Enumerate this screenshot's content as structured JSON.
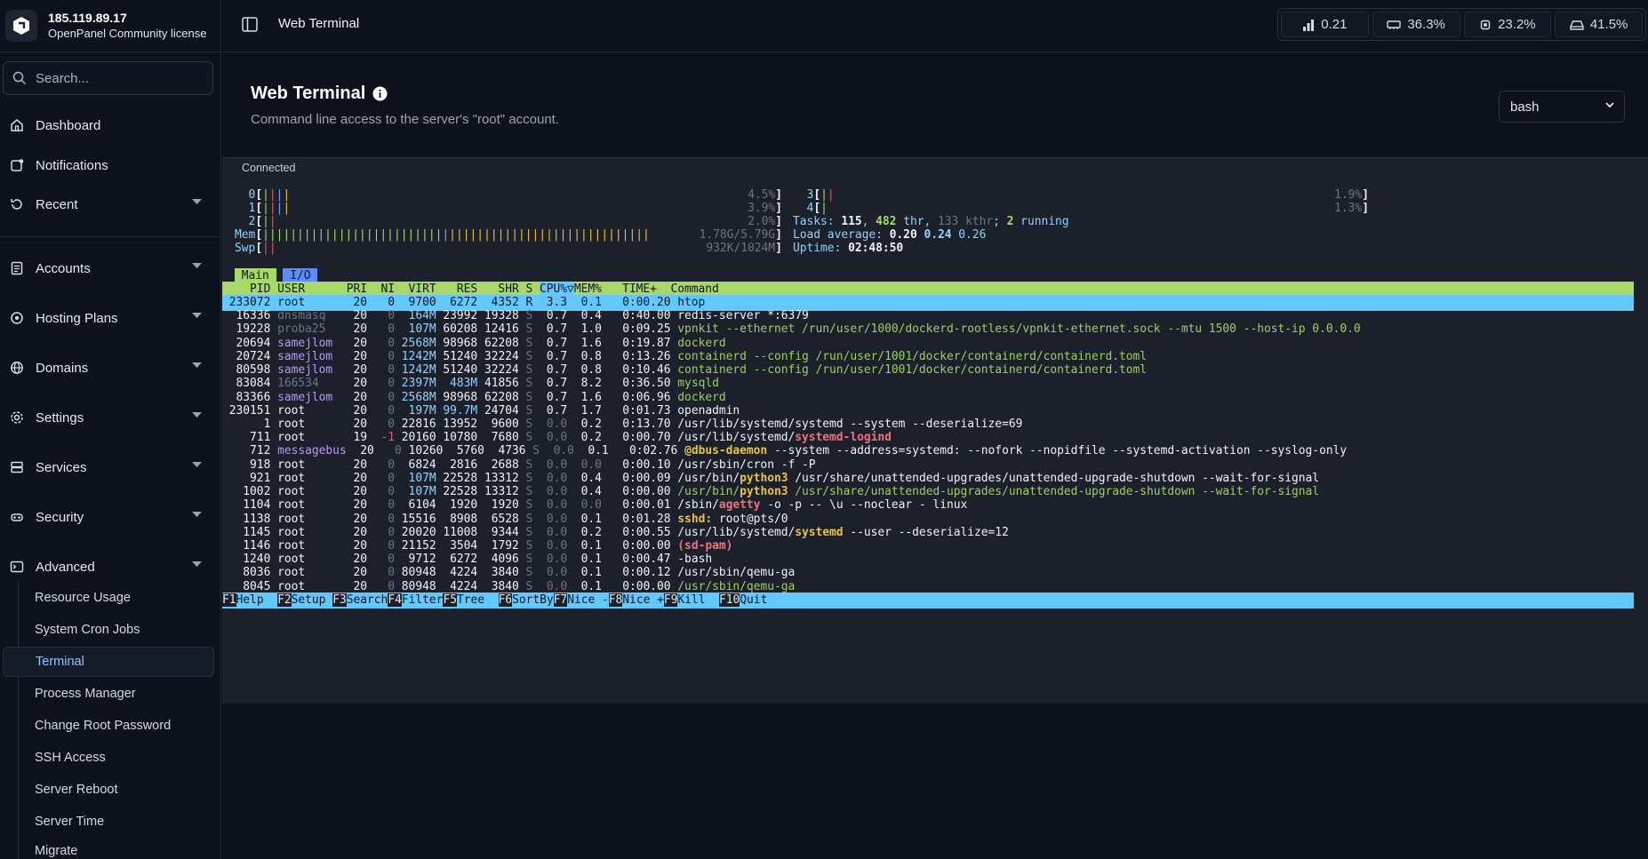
{
  "brand": {
    "ip": "185.119.89.17",
    "license": "OpenPanel Community license"
  },
  "search": {
    "placeholder": "Search..."
  },
  "nav": {
    "dashboard": "Dashboard",
    "notifications": "Notifications",
    "recent": "Recent",
    "accounts": "Accounts",
    "hosting_plans": "Hosting Plans",
    "domains": "Domains",
    "settings": "Settings",
    "services": "Services",
    "security": "Security",
    "advanced": "Advanced",
    "advanced_items": [
      "Resource Usage",
      "System Cron Jobs",
      "Terminal",
      "Process Manager",
      "Change Root Password",
      "SSH Access",
      "Server Reboot",
      "Server Time",
      "Migrate"
    ]
  },
  "topbar": {
    "title": "Web Terminal",
    "stats": {
      "load": "0.21",
      "mem": "36.3%",
      "cpu": "23.2%",
      "disk": "41.5%"
    }
  },
  "page": {
    "title": "Web Terminal",
    "description": "Command line access to the server's \"root\" account.",
    "shell": "bash"
  },
  "terminal": {
    "status": "Connected",
    "cpus": [
      {
        "label": "0",
        "bars": "||||",
        "pct": "4.5%"
      },
      {
        "label": "1",
        "bars": "||||",
        "pct": "3.9%"
      },
      {
        "label": "2",
        "bars": "||",
        "pct": "2.0%"
      },
      {
        "label": "3",
        "bars": "||",
        "pct": "1.9%"
      },
      {
        "label": "4",
        "bars": "|",
        "pct": "1.3%"
      }
    ],
    "mem": {
      "label": "Mem",
      "value": "1.78G/5.79G"
    },
    "swp": {
      "label": "Swp",
      "value": "932K/1024M"
    },
    "tasks": {
      "prefix": "Tasks: ",
      "count": "115",
      "thr": "482",
      "thr_label": " thr",
      "kthr": "133 kthr",
      "running": "2",
      "running_label": " running"
    },
    "load": {
      "prefix": "Load average: ",
      "v1": "0.20",
      "v2": "0.24",
      "v3": "0.26"
    },
    "uptime": {
      "prefix": "Uptime: ",
      "value": "02:48:50"
    },
    "tabs": [
      "Main",
      "I/O"
    ],
    "header": {
      "pid": "PID",
      "user": "USER",
      "pri": "PRI",
      "ni": "NI",
      "virt": "VIRT",
      "res": "RES",
      "shr": "SHR",
      "s": "S",
      "cpu": "CPU%▽",
      "mem": "MEM%",
      "time": "TIME+",
      "cmd": "Command"
    },
    "processes": [
      {
        "pid": "233072",
        "user": "root",
        "pri": "20",
        "ni": "0",
        "virt": "9700",
        "res": "6272",
        "shr": "4352",
        "s": "R",
        "cpu": "3.3",
        "mem": "0.1",
        "time": "0:00.20",
        "cmd": "htop",
        "selected": true
      },
      {
        "pid": "16336",
        "user": "dnsmasq",
        "pri": "20",
        "ni": "0",
        "virt": "164M",
        "res": "23992",
        "shr": "19328",
        "s": "S",
        "cpu": "0.7",
        "mem": "0.4",
        "time": "0:40.00",
        "cmd": "redis-server *:6379"
      },
      {
        "pid": "19228",
        "user": "proba25",
        "pri": "20",
        "ni": "0",
        "virt": "107M",
        "res": "60208",
        "shr": "12416",
        "s": "S",
        "cpu": "0.7",
        "mem": "1.0",
        "time": "0:09.25",
        "cmd": "vpnkit --ethernet /run/user/1000/dockerd-rootless/vpnkit-ethernet.sock --mtu 1500 --host-ip 0.0.0.0"
      },
      {
        "pid": "20694",
        "user": "samejlom",
        "pri": "20",
        "ni": "0",
        "virt": "2568M",
        "res": "98968",
        "shr": "62208",
        "s": "S",
        "cpu": "0.7",
        "mem": "1.6",
        "time": "0:19.87",
        "cmd": "dockerd"
      },
      {
        "pid": "20724",
        "user": "samejlom",
        "pri": "20",
        "ni": "0",
        "virt": "1242M",
        "res": "51240",
        "shr": "32224",
        "s": "S",
        "cpu": "0.7",
        "mem": "0.8",
        "time": "0:13.26",
        "cmd": "containerd --config /run/user/1001/docker/containerd/containerd.toml"
      },
      {
        "pid": "80598",
        "user": "samejlom",
        "pri": "20",
        "ni": "0",
        "virt": "1242M",
        "res": "51240",
        "shr": "32224",
        "s": "S",
        "cpu": "0.7",
        "mem": "0.8",
        "time": "0:10.46",
        "cmd": "containerd --config /run/user/1001/docker/containerd/containerd.toml"
      },
      {
        "pid": "83084",
        "user": "166534",
        "pri": "20",
        "ni": "0",
        "virt": "2397M",
        "res": "483M",
        "shr": "41856",
        "s": "S",
        "cpu": "0.7",
        "mem": "8.2",
        "time": "0:36.50",
        "cmd": "mysqld"
      },
      {
        "pid": "83366",
        "user": "samejlom",
        "pri": "20",
        "ni": "0",
        "virt": "2568M",
        "res": "98968",
        "shr": "62208",
        "s": "S",
        "cpu": "0.7",
        "mem": "1.6",
        "time": "0:06.96",
        "cmd": "dockerd"
      },
      {
        "pid": "230151",
        "user": "root",
        "pri": "20",
        "ni": "0",
        "virt": "197M",
        "res": "99.7M",
        "shr": "24704",
        "s": "S",
        "cpu": "0.7",
        "mem": "1.7",
        "time": "0:01.73",
        "cmd": "openadmin"
      },
      {
        "pid": "1",
        "user": "root",
        "pri": "20",
        "ni": "0",
        "virt": "22816",
        "res": "13952",
        "shr": "9600",
        "s": "S",
        "cpu": "0.0",
        "mem": "0.2",
        "time": "0:13.70",
        "cmd": "/usr/lib/systemd/systemd --system --deserialize=69"
      },
      {
        "pid": "711",
        "user": "root",
        "pri": "19",
        "ni": "-1",
        "virt": "20160",
        "res": "10780",
        "shr": "7680",
        "s": "S",
        "cpu": "0.0",
        "mem": "0.2",
        "time": "0:00.70",
        "cmd": "/usr/lib/systemd/systemd-logind"
      },
      {
        "pid": "712",
        "user": "messagebus",
        "pri": "20",
        "ni": "0",
        "virt": "10260",
        "res": "5760",
        "shr": "4736",
        "s": "S",
        "cpu": "0.0",
        "mem": "0.1",
        "time": "0:02.76",
        "cmd": "@dbus-daemon --system --address=systemd: --nofork --nopidfile --systemd-activation --syslog-only"
      },
      {
        "pid": "918",
        "user": "root",
        "pri": "20",
        "ni": "0",
        "virt": "6824",
        "res": "2816",
        "shr": "2688",
        "s": "S",
        "cpu": "0.0",
        "mem": "0.0",
        "time": "0:00.10",
        "cmd": "/usr/sbin/cron -f -P"
      },
      {
        "pid": "921",
        "user": "root",
        "pri": "20",
        "ni": "0",
        "virt": "107M",
        "res": "22528",
        "shr": "13312",
        "s": "S",
        "cpu": "0.0",
        "mem": "0.4",
        "time": "0:00.09",
        "cmd": "/usr/bin/python3 /usr/share/unattended-upgrades/unattended-upgrade-shutdown --wait-for-signal"
      },
      {
        "pid": "1002",
        "user": "root",
        "pri": "20",
        "ni": "0",
        "virt": "107M",
        "res": "22528",
        "shr": "13312",
        "s": "S",
        "cpu": "0.0",
        "mem": "0.4",
        "time": "0:00.00",
        "cmd": "/usr/bin/python3 /usr/share/unattended-upgrades/unattended-upgrade-shutdown --wait-for-signal"
      },
      {
        "pid": "1104",
        "user": "root",
        "pri": "20",
        "ni": "0",
        "virt": "6104",
        "res": "1920",
        "shr": "1920",
        "s": "S",
        "cpu": "0.0",
        "mem": "0.0",
        "time": "0:00.01",
        "cmd": "/sbin/agetty -o -p -- \\u --noclear - linux"
      },
      {
        "pid": "1138",
        "user": "root",
        "pri": "20",
        "ni": "0",
        "virt": "15516",
        "res": "8908",
        "shr": "6528",
        "s": "S",
        "cpu": "0.0",
        "mem": "0.1",
        "time": "0:01.28",
        "cmd": "sshd: root@pts/0"
      },
      {
        "pid": "1145",
        "user": "root",
        "pri": "20",
        "ni": "0",
        "virt": "20020",
        "res": "11008",
        "shr": "9344",
        "s": "S",
        "cpu": "0.0",
        "mem": "0.2",
        "time": "0:00.55",
        "cmd": "/usr/lib/systemd/systemd --user --deserialize=12"
      },
      {
        "pid": "1146",
        "user": "root",
        "pri": "20",
        "ni": "0",
        "virt": "21152",
        "res": "3504",
        "shr": "1792",
        "s": "S",
        "cpu": "0.0",
        "mem": "0.1",
        "time": "0:00.00",
        "cmd": "(sd-pam)"
      },
      {
        "pid": "1240",
        "user": "root",
        "pri": "20",
        "ni": "0",
        "virt": "9712",
        "res": "6272",
        "shr": "4096",
        "s": "S",
        "cpu": "0.0",
        "mem": "0.1",
        "time": "0:00.47",
        "cmd": "-bash"
      },
      {
        "pid": "8036",
        "user": "root",
        "pri": "20",
        "ni": "0",
        "virt": "80948",
        "res": "4224",
        "shr": "3840",
        "s": "S",
        "cpu": "0.0",
        "mem": "0.1",
        "time": "0:00.12",
        "cmd": "/usr/sbin/qemu-ga"
      },
      {
        "pid": "8045",
        "user": "root",
        "pri": "20",
        "ni": "0",
        "virt": "80948",
        "res": "4224",
        "shr": "3840",
        "s": "S",
        "cpu": "0.0",
        "mem": "0.1",
        "time": "0:00.00",
        "cmd": "/usr/sbin/qemu-ga"
      }
    ],
    "fkeys": [
      {
        "key": "F1",
        "label": "Help  "
      },
      {
        "key": "F2",
        "label": "Setup "
      },
      {
        "key": "F3",
        "label": "Search"
      },
      {
        "key": "F4",
        "label": "Filter"
      },
      {
        "key": "F5",
        "label": "Tree  "
      },
      {
        "key": "F6",
        "label": "SortBy"
      },
      {
        "key": "F7",
        "label": "Nice -"
      },
      {
        "key": "F8",
        "label": "Nice +"
      },
      {
        "key": "F9",
        "label": "Kill  "
      },
      {
        "key": "F10",
        "label": "Quit"
      }
    ]
  },
  "colors": {
    "accent": "#62c8ff",
    "header_bg": "#a8d86a",
    "sidebar_bg": "#0c111b",
    "terminal_bg": "#1b202b"
  }
}
